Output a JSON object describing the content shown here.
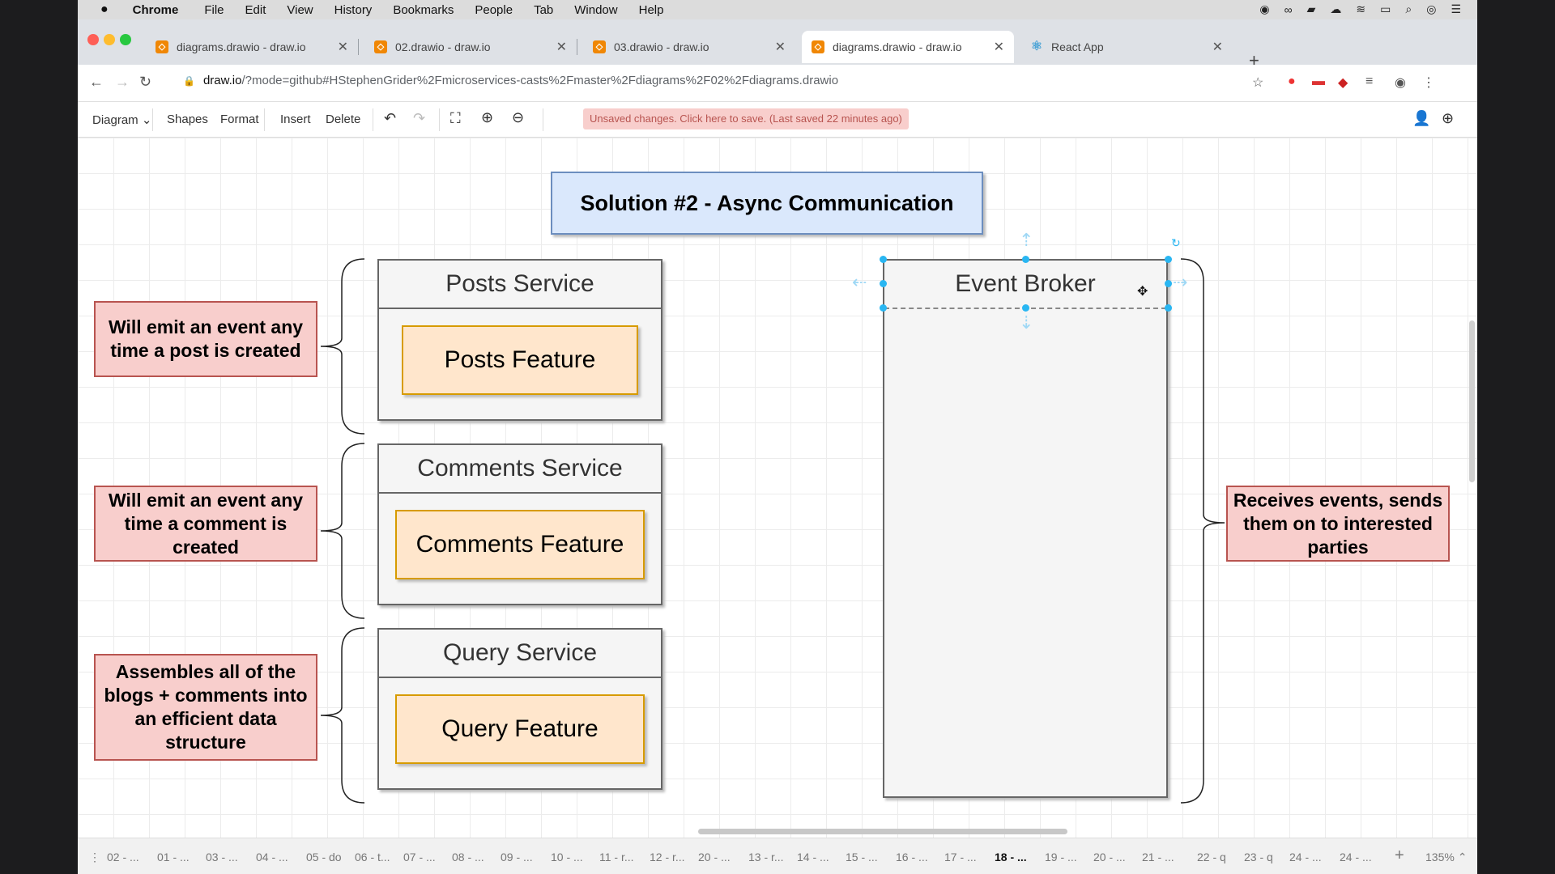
{
  "menubar": {
    "apple": "",
    "app": "Chrome",
    "items": [
      "File",
      "Edit",
      "View",
      "History",
      "Bookmarks",
      "People",
      "Tab",
      "Window",
      "Help"
    ]
  },
  "tabs": [
    {
      "label": "diagrams.drawio - draw.io",
      "active": false
    },
    {
      "label": "02.drawio - draw.io",
      "active": false
    },
    {
      "label": "03.drawio - draw.io",
      "active": false
    },
    {
      "label": "diagrams.drawio - draw.io",
      "active": true
    },
    {
      "label": "React App",
      "active": false
    }
  ],
  "address": {
    "host": "draw.io",
    "path": "/?mode=github#HStephenGrider%2Fmicroservices-casts%2Fmaster%2Fdiagrams%2F02%2Fdiagrams.drawio"
  },
  "toolbar": {
    "diagram": "Diagram",
    "shapes": "Shapes",
    "format": "Format",
    "insert": "Insert",
    "delete": "Delete",
    "unsaved": "Unsaved changes. Click here to save. (Last saved 22 minutes ago)"
  },
  "diagram": {
    "title": "Solution #2 - Async Communication",
    "services": [
      {
        "header": "Posts Service",
        "feature": "Posts Feature",
        "note": "Will emit an event any time a post is created"
      },
      {
        "header": "Comments Service",
        "feature": "Comments Feature",
        "note": "Will emit an event any time a comment is created"
      },
      {
        "header": "Query Service",
        "feature": "Query Feature",
        "note": "Assembles all of the blogs + comments into an efficient data structure"
      }
    ],
    "broker": "Event Broker",
    "broker_note": "Receives events, sends them on to interested parties"
  },
  "pages": [
    "02 - ...",
    "01 - ...",
    "03 - ...",
    "04 - ...",
    "05 - do",
    "06 - t...",
    "07 - ...",
    "08 - ...",
    "09 - ...",
    "10 - ...",
    "11 - r...",
    "12 - r...",
    "20 - ...",
    "13 - r...",
    "14 - ...",
    "15 - ...",
    "16 - ...",
    "17 - ...",
    "18 - ...",
    "19 - ...",
    "20 - ...",
    "21 - ...",
    "22 - q",
    "23 - q",
    "24 - ...",
    "24 - ..."
  ],
  "active_page": "18 - ...",
  "zoom": "135%"
}
